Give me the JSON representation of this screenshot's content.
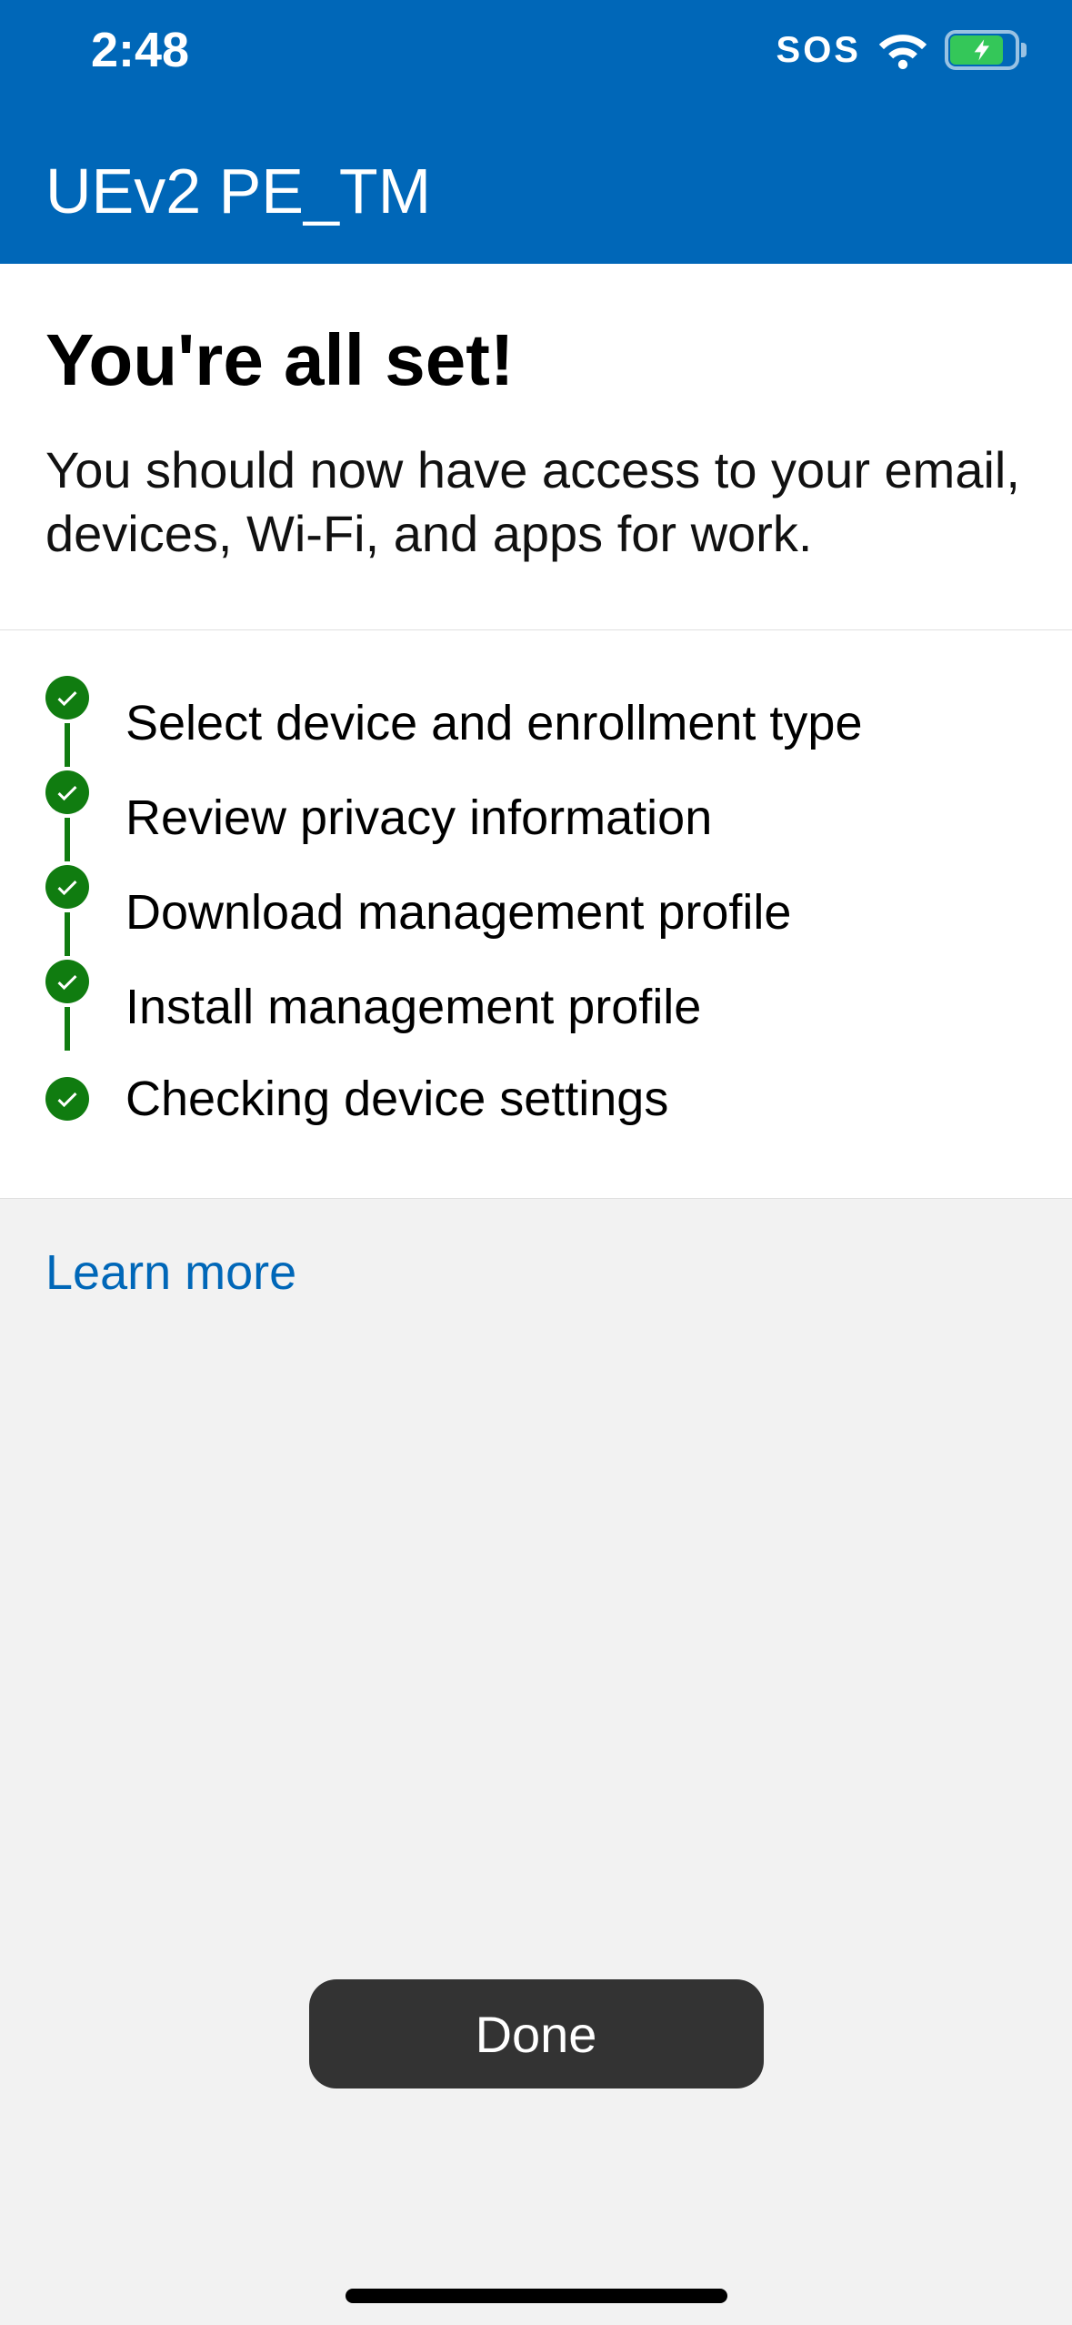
{
  "status_bar": {
    "time": "2:48",
    "sos_label": "SOS"
  },
  "header": {
    "title": "UEv2 PE_TM"
  },
  "intro": {
    "heading": "You're all set!",
    "body": "You should now have access to your email, devices, Wi-Fi, and apps for work."
  },
  "checklist": {
    "items": [
      {
        "label": "Select device and enrollment type"
      },
      {
        "label": "Review privacy information"
      },
      {
        "label": "Download management profile"
      },
      {
        "label": "Install management profile"
      },
      {
        "label": "Checking device settings"
      }
    ]
  },
  "links": {
    "learn_more": "Learn more"
  },
  "buttons": {
    "done": "Done"
  },
  "colors": {
    "brand_blue": "#0067B8",
    "success_green": "#107C10",
    "button_dark": "#333333"
  }
}
